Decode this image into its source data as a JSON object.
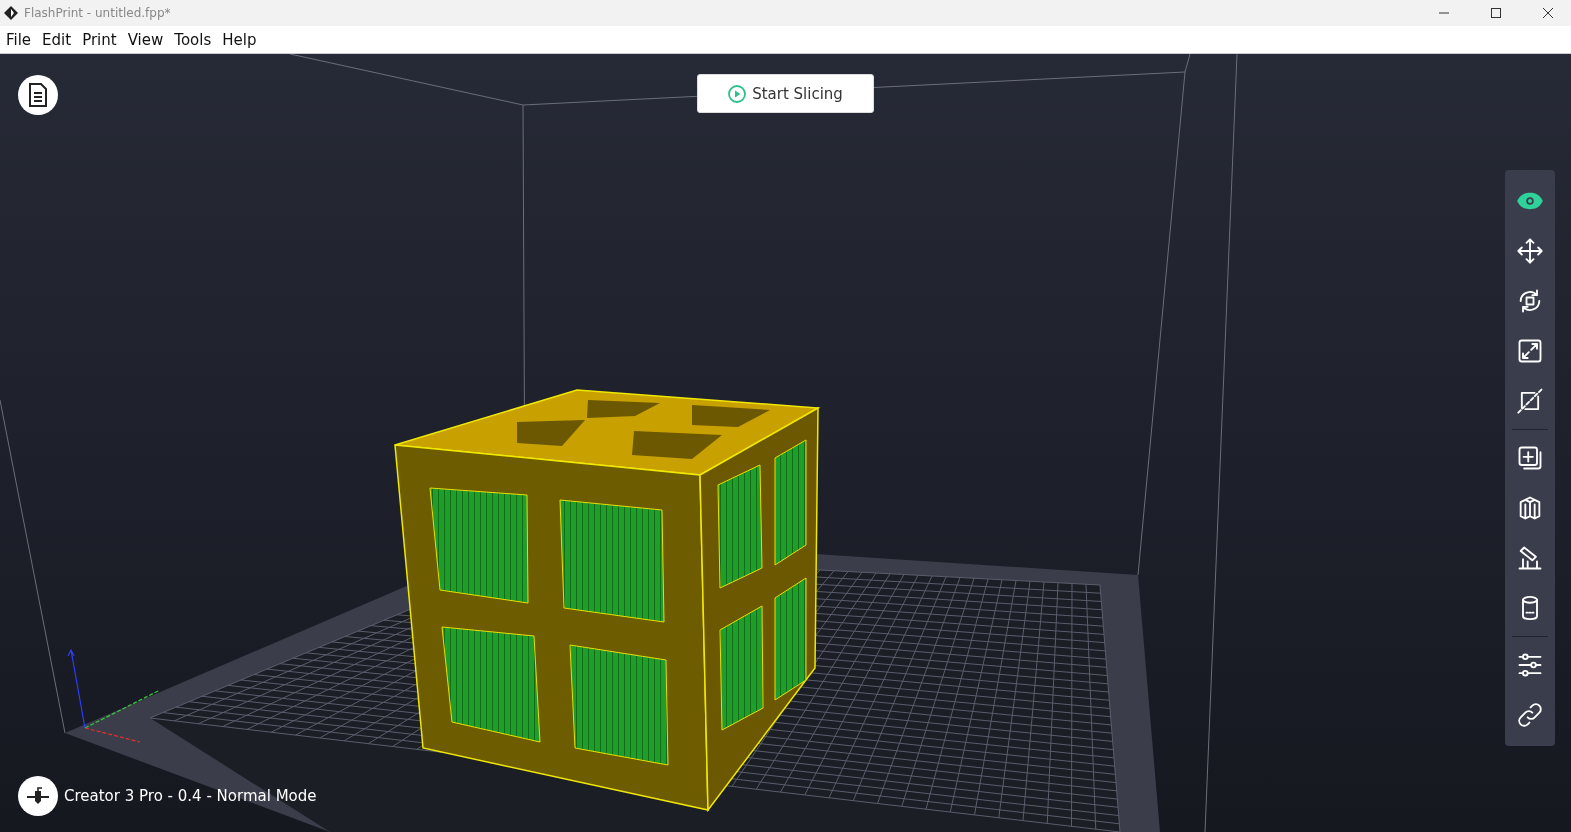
{
  "window": {
    "title": "FlashPrint - untitled.fpp*"
  },
  "menu": [
    "File",
    "Edit",
    "Print",
    "View",
    "Tools",
    "Help"
  ],
  "slice_button": {
    "label": "Start Slicing"
  },
  "toolbar": {
    "groups": [
      [
        {
          "kind": "view",
          "selected": true
        },
        {
          "kind": "move",
          "selected": false
        },
        {
          "kind": "rotate",
          "selected": false
        },
        {
          "kind": "scale",
          "selected": false
        },
        {
          "kind": "cut",
          "selected": false
        }
      ],
      [
        {
          "kind": "add",
          "selected": false
        },
        {
          "kind": "split",
          "selected": false
        },
        {
          "kind": "support",
          "selected": false
        },
        {
          "kind": "hollow",
          "selected": false
        }
      ],
      [
        {
          "kind": "settings",
          "selected": false
        },
        {
          "kind": "link",
          "selected": false
        }
      ]
    ]
  },
  "printer_status": "Creator 3 Pro - 0.4 - Normal Mode"
}
